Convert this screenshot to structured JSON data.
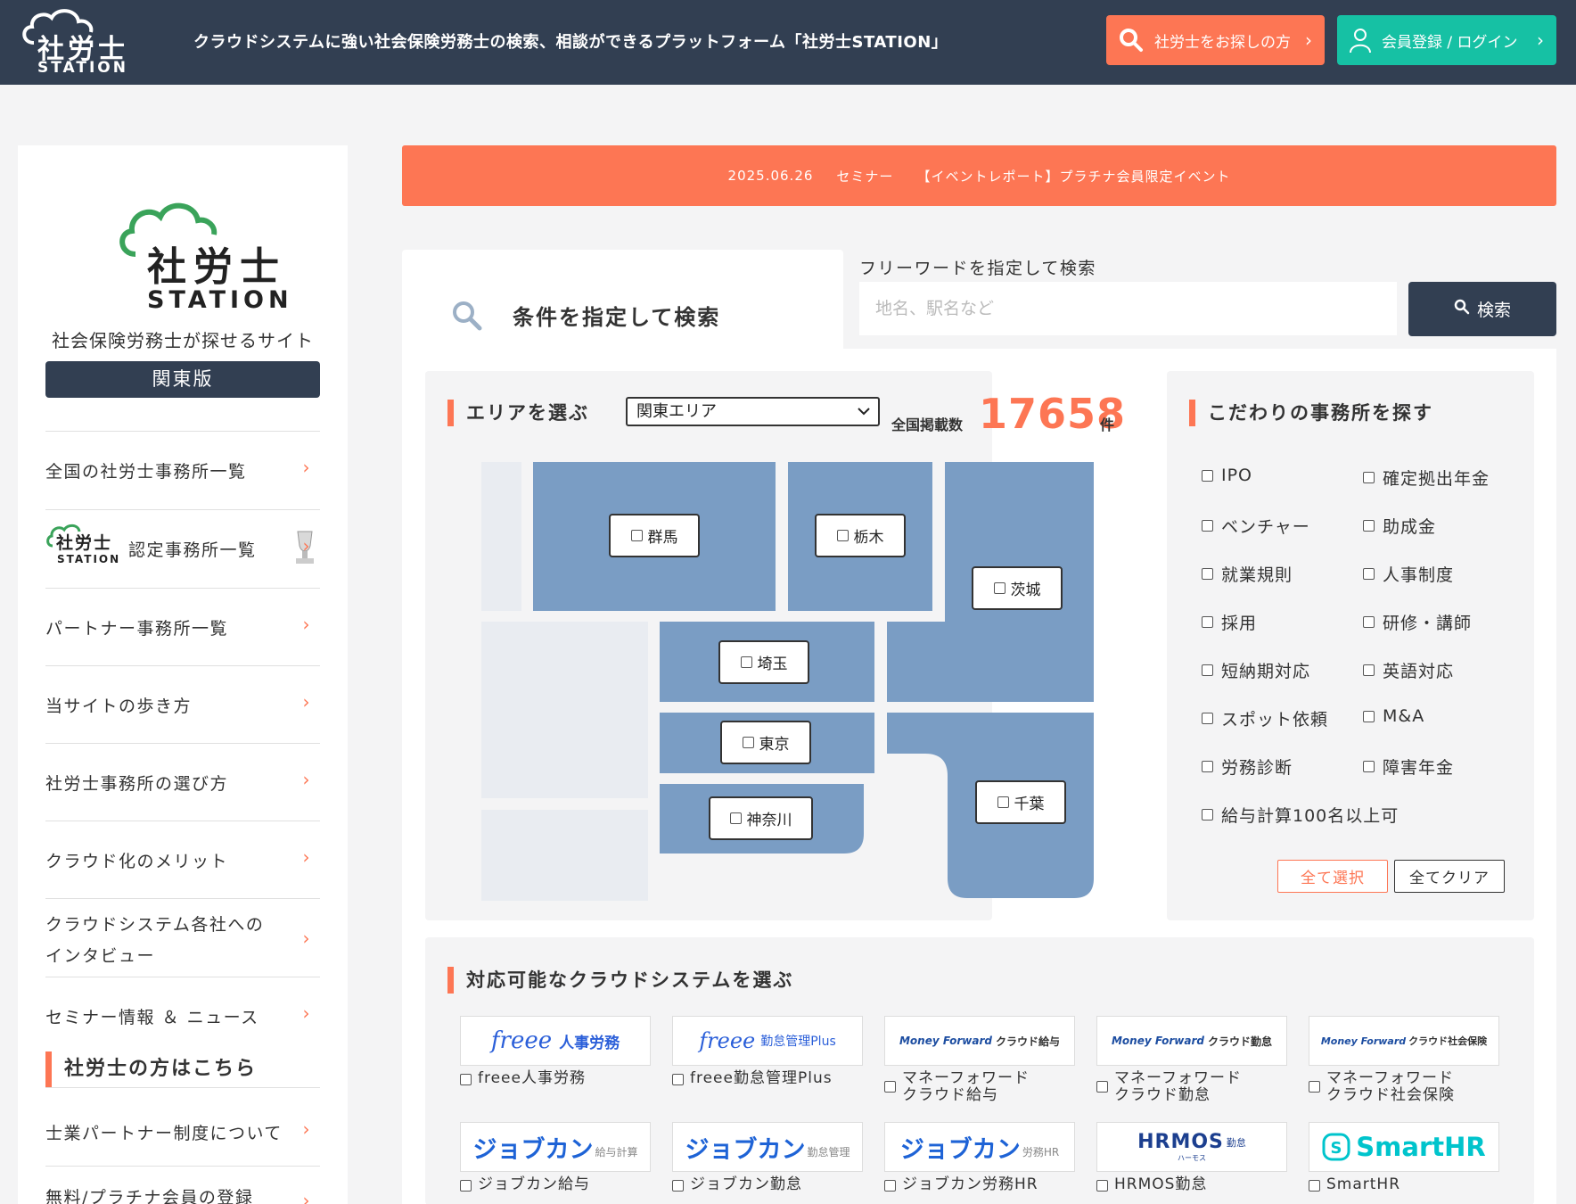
{
  "header": {
    "logo_kanji": "社労士",
    "logo_station": "STATION",
    "tagline": "クラウドシステムに強い社会保険労務士の検索、相談ができるプラットフォーム「社労士STATION」",
    "find_button": "社労士をお探しの方",
    "login_button": "会員登録 / ログイン",
    "colors": {
      "bg": "#323f52",
      "find": "#fd7654",
      "login": "#16c1a4"
    }
  },
  "sidebar": {
    "logo_kanji": "社労士",
    "logo_station": "STATION",
    "subtitle": "社会保険労務士が探せるサイト",
    "edition": "関東版",
    "items": [
      {
        "label": "全国の社労士事務所一覧"
      },
      {
        "label": "認定事務所一覧"
      },
      {
        "label": "パートナー事務所一覧"
      },
      {
        "label": "当サイトの歩き方"
      },
      {
        "label": "社労士事務所の選び方"
      },
      {
        "label": "クラウド化のメリット"
      },
      {
        "label_line1": "クラウドシステム各社への",
        "label_line2": "インタビュー"
      },
      {
        "label": "セミナー情報 ＆ ニュース"
      }
    ],
    "section_heading": "社労士の方はこちら",
    "section_items": [
      {
        "label": "士業パートナー制度について"
      },
      {
        "label": "無料/プラチナ会員の登録"
      }
    ]
  },
  "banner": {
    "date": "2025.06.26",
    "category": "セミナー",
    "title": "【イベントレポート】プラチナ会員限定イベント"
  },
  "search": {
    "condition_tab": "条件を指定して検索",
    "free_label": "フリーワードを指定して検索",
    "free_placeholder": "地名、駅名など",
    "button": "検索"
  },
  "area": {
    "title": "エリアを選ぶ",
    "selected": "関東エリア",
    "total_label": "全国掲載数",
    "total": "17658",
    "unit": "件",
    "prefectures": [
      "群馬",
      "栃木",
      "茨城",
      "埼玉",
      "東京",
      "神奈川",
      "千葉"
    ]
  },
  "features": {
    "title": "こだわりの事務所を探す",
    "items": [
      "IPO",
      "確定拠出年金",
      "ベンチャー",
      "助成金",
      "就業規則",
      "人事制度",
      "採用",
      "研修・講師",
      "短納期対応",
      "英語対応",
      "スポット依頼",
      "M&A",
      "労務診断",
      "障害年金",
      "給与計算100名以上可"
    ],
    "select_all": "全て選択",
    "clear_all": "全てクリア"
  },
  "cloud": {
    "title": "対応可能なクラウドシステムを選ぶ",
    "systems": [
      {
        "logo": "freee",
        "logo_sub": "人事労務",
        "label1": "freee人事労務",
        "label2": ""
      },
      {
        "logo": "freee",
        "logo_sub": "勤怠管理Plus",
        "label1": "freee勤怠管理Plus",
        "label2": ""
      },
      {
        "logo": "Money Forward",
        "logo_sub": "クラウド給与",
        "label1": "マネーフォワード",
        "label2": "クラウド給与"
      },
      {
        "logo": "Money Forward",
        "logo_sub": "クラウド勤怠",
        "label1": "マネーフォワード",
        "label2": "クラウド勤怠"
      },
      {
        "logo": "Money Forward",
        "logo_sub": "クラウド社会保険",
        "label1": "マネーフォワード",
        "label2": "クラウド社会保険"
      },
      {
        "logo": "ジョブカン",
        "logo_sub": "給与計算",
        "label1": "ジョブカン給与",
        "label2": ""
      },
      {
        "logo": "ジョブカン",
        "logo_sub": "勤怠管理",
        "label1": "ジョブカン勤怠",
        "label2": ""
      },
      {
        "logo": "ジョブカン",
        "logo_sub": "労務HR",
        "label1": "ジョブカン労務HR",
        "label2": ""
      },
      {
        "logo": "HRMOS",
        "logo_sub": "勤怠",
        "logo_sub2": "ハーモス",
        "label1": "HRMOS勤怠",
        "label2": ""
      },
      {
        "logo": "SmartHR",
        "logo_sub": "",
        "label1": "SmartHR",
        "label2": ""
      }
    ]
  }
}
